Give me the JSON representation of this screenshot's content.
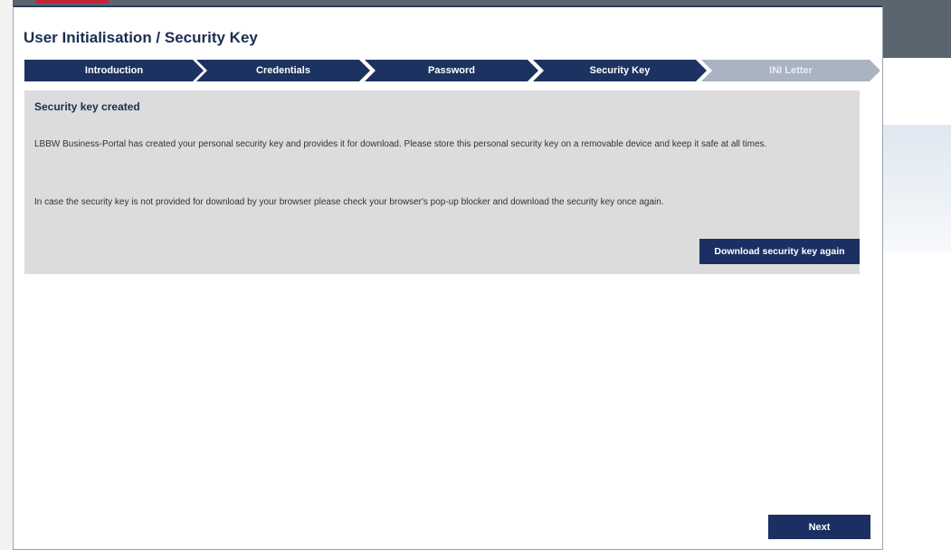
{
  "dialog": {
    "title": "User Initialisation / Security Key"
  },
  "stepper": {
    "steps": [
      {
        "label": "Introduction",
        "state": "done"
      },
      {
        "label": "Credentials",
        "state": "done"
      },
      {
        "label": "Password",
        "state": "done"
      },
      {
        "label": "Security Key",
        "state": "current"
      },
      {
        "label": "INI Letter",
        "state": "todo"
      }
    ]
  },
  "panel": {
    "heading": "Security key created",
    "paragraph1": "LBBW Business-Portal has created your personal security key and provides it for download. Please store this personal security key on a removable device and keep it safe at all times.",
    "paragraph2": "In case the security key is not provided for download by your browser please check your browser's pop-up blocker and download the security key once again.",
    "download_button": "Download security key again"
  },
  "footer": {
    "next_button": "Next"
  },
  "colors": {
    "primary": "#1c3260",
    "inactive_step": "#a9b3c1",
    "panel_bg": "#dcdcdc"
  }
}
